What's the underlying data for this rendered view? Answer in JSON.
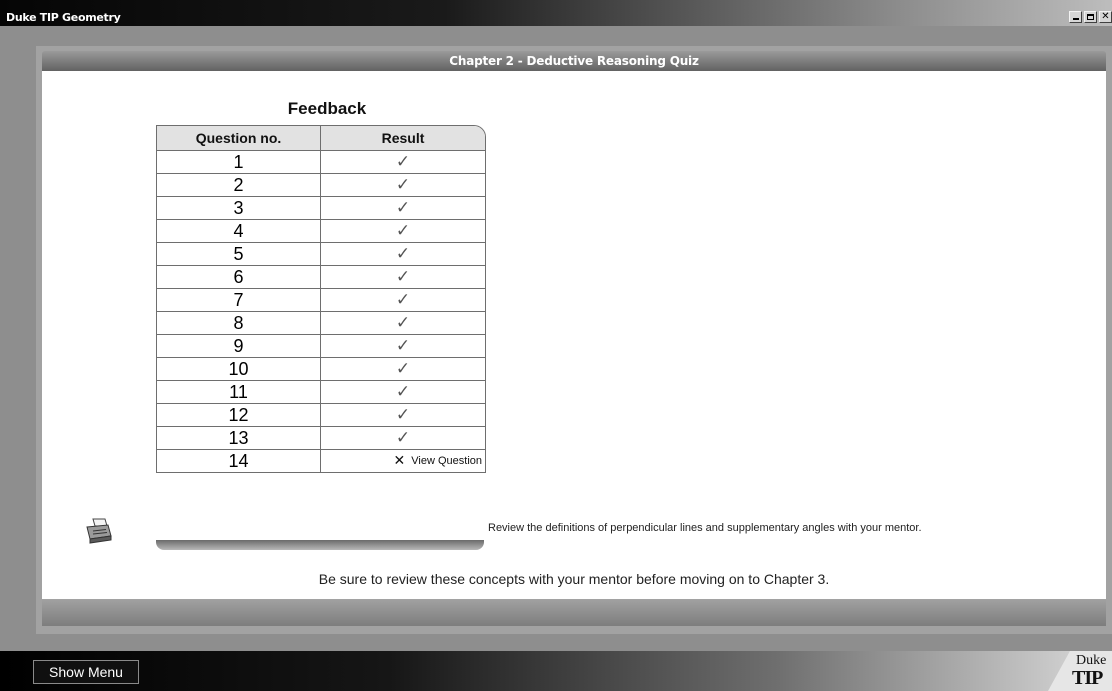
{
  "window": {
    "title": "Duke TIP Geometry",
    "controls": {
      "close": "✕"
    }
  },
  "quiz": {
    "header": "Chapter 2 - Deductive Reasoning Quiz",
    "feedback_title": "Feedback",
    "columns": {
      "question": "Question no.",
      "result": "Result"
    },
    "rows": [
      {
        "q": "1",
        "result": "✓",
        "correct": true
      },
      {
        "q": "2",
        "result": "✓",
        "correct": true
      },
      {
        "q": "3",
        "result": "✓",
        "correct": true
      },
      {
        "q": "4",
        "result": "✓",
        "correct": true
      },
      {
        "q": "5",
        "result": "✓",
        "correct": true
      },
      {
        "q": "6",
        "result": "✓",
        "correct": true
      },
      {
        "q": "7",
        "result": "✓",
        "correct": true
      },
      {
        "q": "8",
        "result": "✓",
        "correct": true
      },
      {
        "q": "9",
        "result": "✓",
        "correct": true
      },
      {
        "q": "10",
        "result": "✓",
        "correct": true
      },
      {
        "q": "11",
        "result": "✓",
        "correct": true
      },
      {
        "q": "12",
        "result": "✓",
        "correct": true
      },
      {
        "q": "13",
        "result": "✓",
        "correct": true
      },
      {
        "q": "14",
        "result": "✕",
        "correct": false,
        "link": "View Question"
      }
    ],
    "review_note": "Review the definitions of perpendicular lines and supplementary angles with your mentor.",
    "bottom_message": "Be sure to review these concepts with your mentor before moving on to Chapter 3.",
    "print_icon": "printer-icon"
  },
  "footer": {
    "menu_button": "Show Menu",
    "logo": {
      "line1": "Duke",
      "line2": "TIP"
    }
  }
}
